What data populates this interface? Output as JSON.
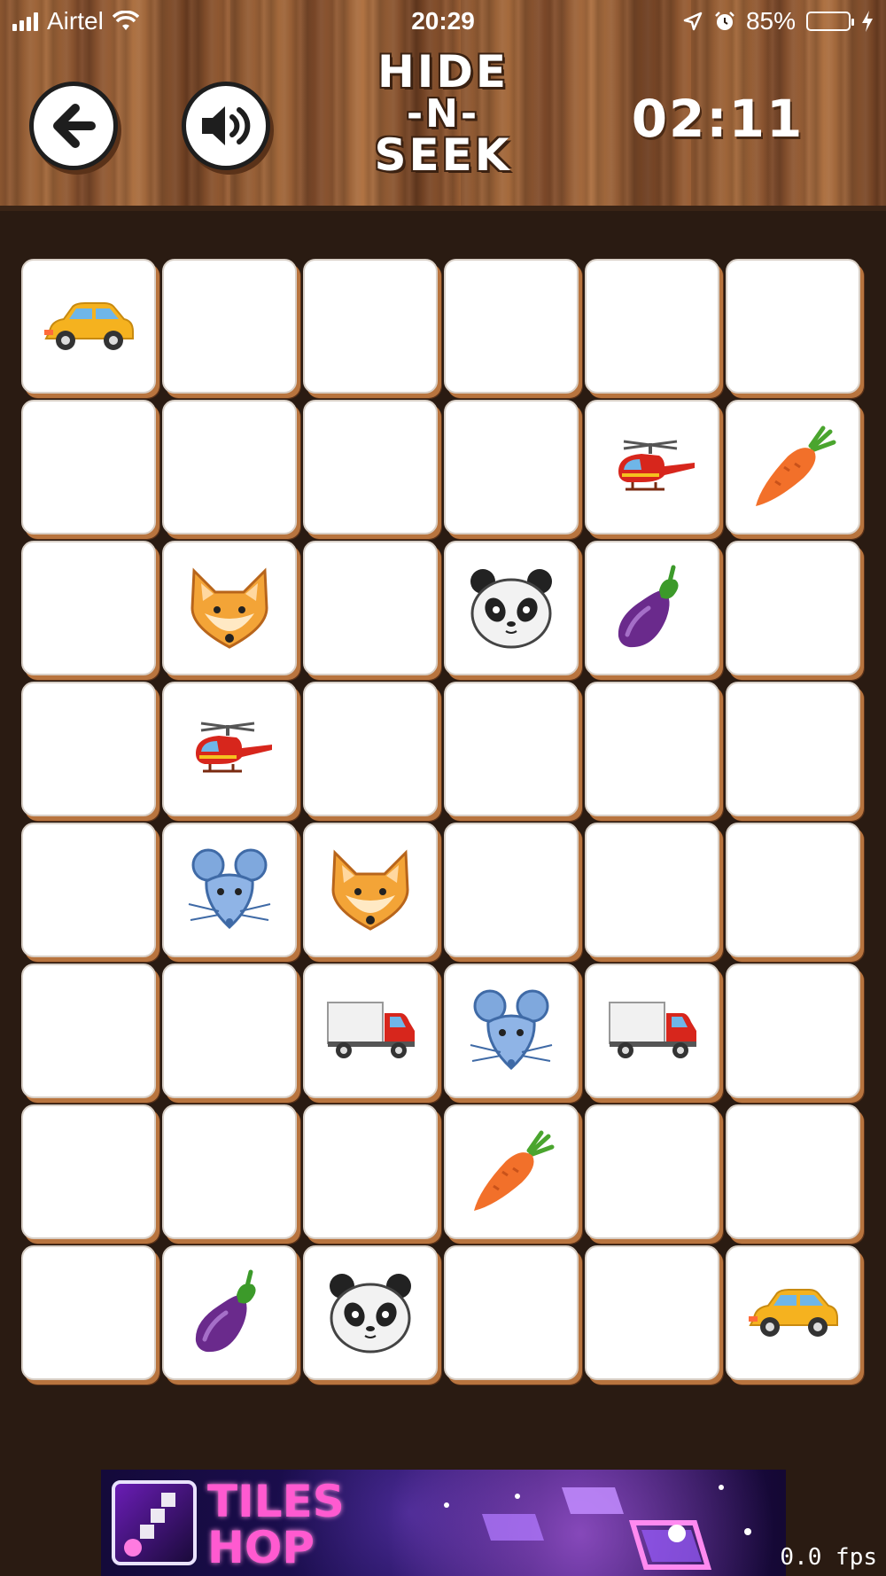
{
  "status_bar": {
    "carrier": "Airtel",
    "time": "20:29",
    "battery_percent": "85%",
    "battery_level": 0.85
  },
  "header": {
    "title_lines": [
      "HIDE",
      "-N-",
      "SEEK"
    ],
    "timer": "02:11",
    "back_icon": "arrow-left-icon",
    "sound_icon": "speaker-icon"
  },
  "board": {
    "columns": 6,
    "rows": 8,
    "cells": [
      [
        "car",
        "",
        "",
        "",
        "",
        ""
      ],
      [
        "",
        "",
        "",
        "",
        "helicopter",
        "carrot"
      ],
      [
        "",
        "fox",
        "",
        "panda",
        "eggplant",
        ""
      ],
      [
        "",
        "helicopter",
        "",
        "",
        "",
        ""
      ],
      [
        "",
        "mouse",
        "fox",
        "",
        "",
        ""
      ],
      [
        "",
        "",
        "truck",
        "mouse",
        "truck",
        ""
      ],
      [
        "",
        "",
        "",
        "carrot",
        "",
        ""
      ],
      [
        "",
        "eggplant",
        "panda",
        "",
        "",
        "car"
      ]
    ]
  },
  "ad": {
    "title_lines": [
      "TILES",
      "HOP"
    ]
  },
  "debug": {
    "fps": "0.0 fps"
  },
  "colors": {
    "wood": "#8e5a33",
    "board_bg": "#2a1b12",
    "tile_shadow": "#b8743e"
  }
}
